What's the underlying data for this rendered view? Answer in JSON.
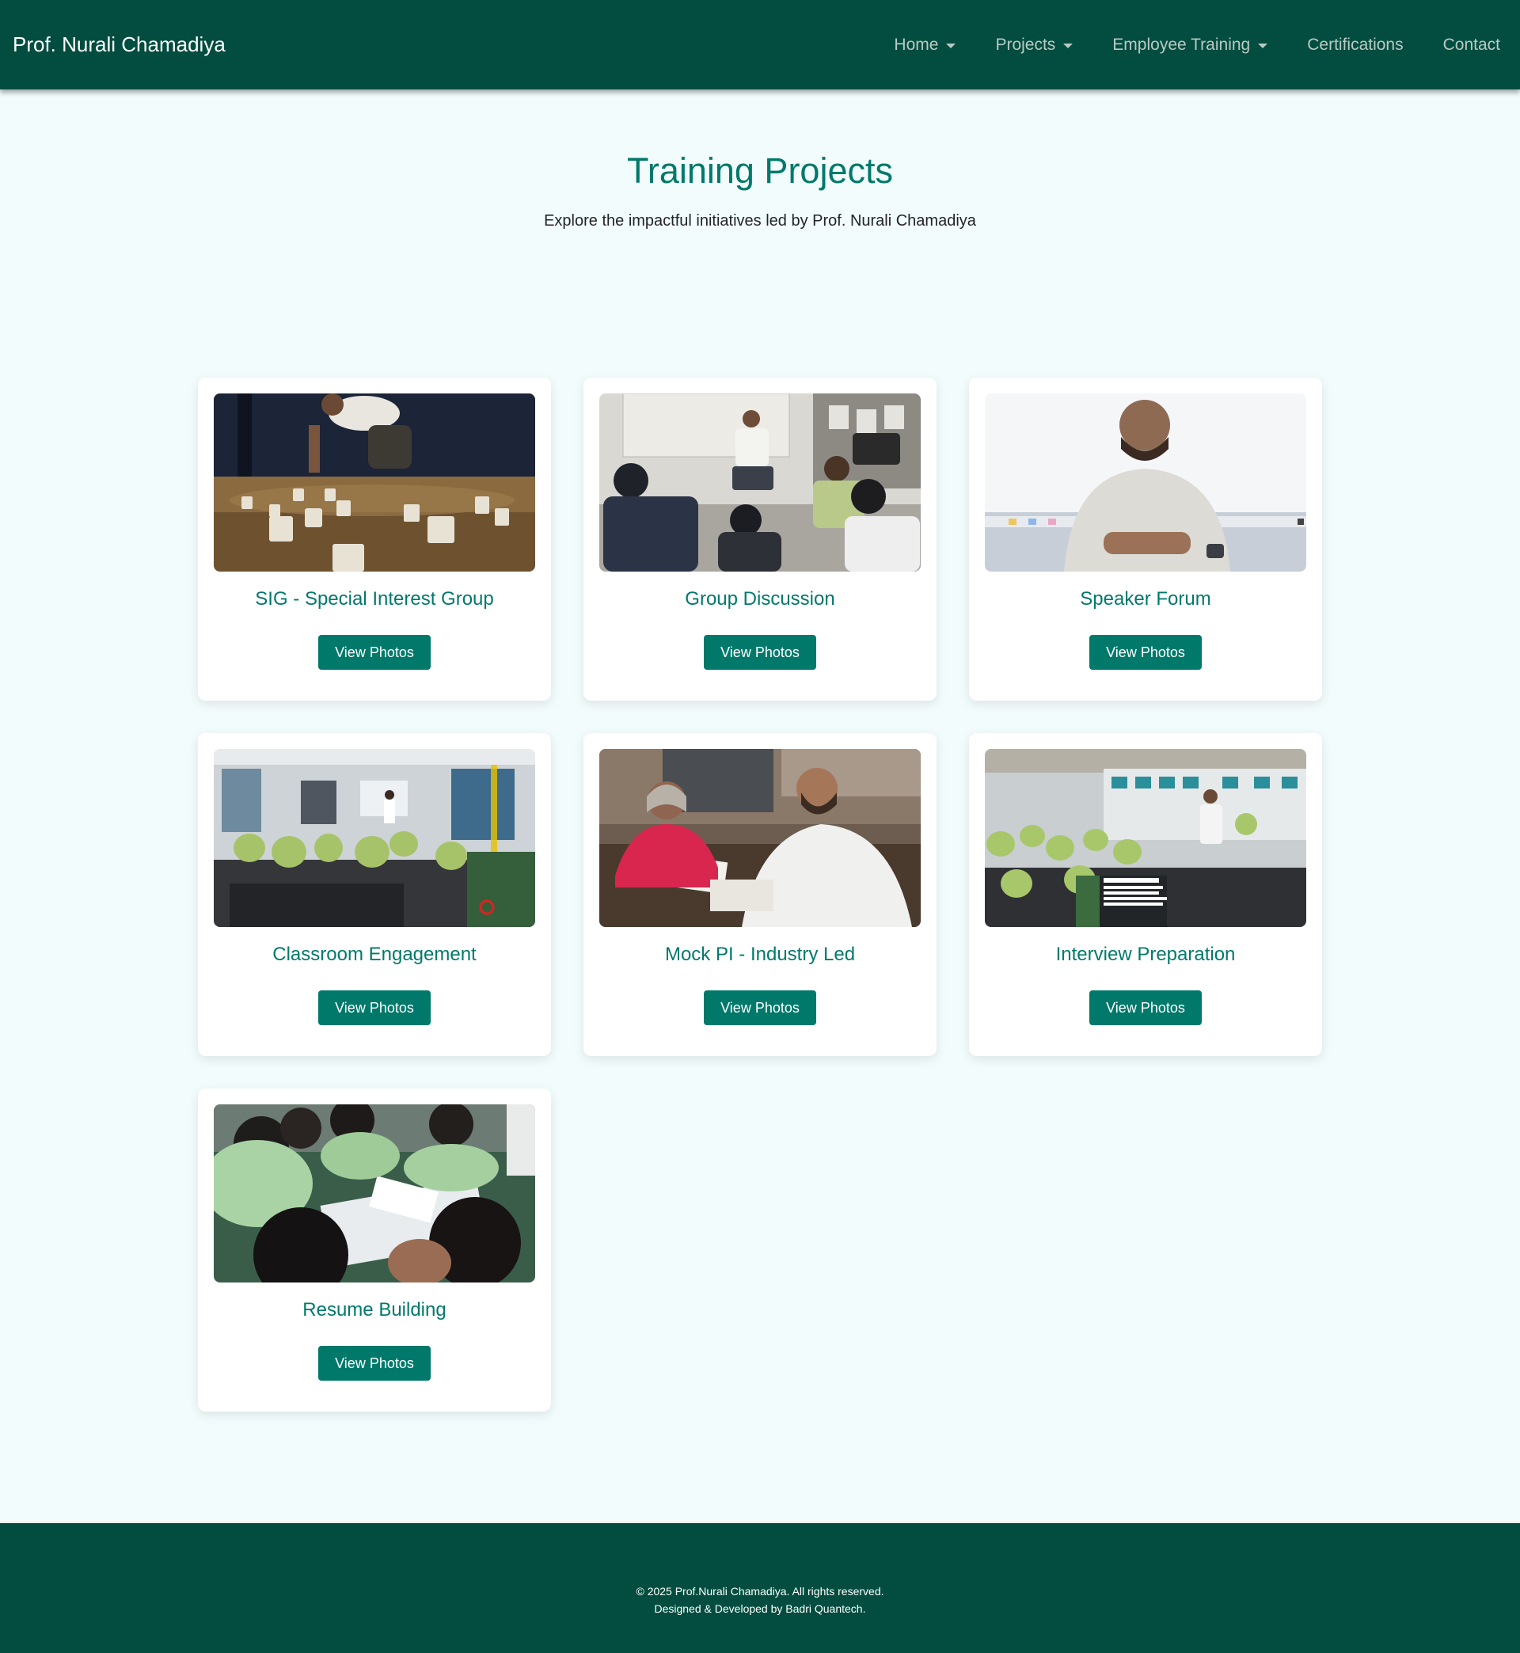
{
  "navbar": {
    "brand": "Prof. Nurali Chamadiya",
    "items": [
      {
        "label": "Home",
        "dropdown": true
      },
      {
        "label": "Projects",
        "dropdown": true
      },
      {
        "label": "Employee Training",
        "dropdown": true
      },
      {
        "label": "Certifications",
        "dropdown": false
      },
      {
        "label": "Contact",
        "dropdown": false
      }
    ]
  },
  "hero": {
    "title": "Training Projects",
    "subtitle": "Explore the impactful initiatives led by Prof. Nurali Chamadiya"
  },
  "projects": [
    {
      "title": "SIG - Special Interest Group",
      "button": "View Photos"
    },
    {
      "title": "Group Discussion",
      "button": "View Photos"
    },
    {
      "title": "Speaker Forum",
      "button": "View Photos"
    },
    {
      "title": "Classroom Engagement",
      "button": "View Photos"
    },
    {
      "title": "Mock PI - Industry Led",
      "button": "View Photos"
    },
    {
      "title": "Interview Preparation",
      "button": "View Photos"
    },
    {
      "title": "Resume Building",
      "button": "View Photos"
    }
  ],
  "footer": {
    "copyright": "© 2025 Prof.Nurali Chamadiya. All rights reserved.",
    "credit": "Designed & Developed by Badri Quantech."
  },
  "colors": {
    "navbar_bg": "#024d3f",
    "accent": "#00796b",
    "page_bg": "#f3fcfd"
  }
}
